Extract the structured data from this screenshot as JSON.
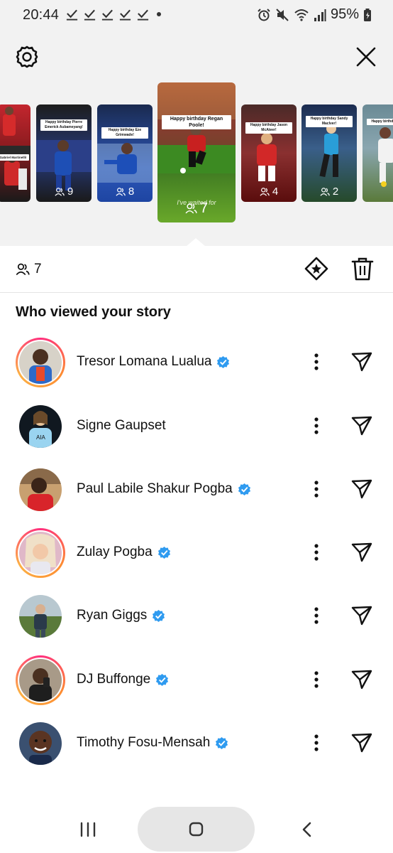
{
  "status_bar": {
    "time": "20:44",
    "battery": "95%",
    "icons": [
      "check-icon",
      "check-icon",
      "check-icon",
      "check-icon",
      "check-icon",
      "dot-icon",
      "alarm-icon",
      "mute-icon",
      "wifi-icon",
      "signal-icon",
      "battery-charging-icon"
    ]
  },
  "header": {
    "settings_icon": "settings-gear-icon",
    "close_icon": "close-icon"
  },
  "stories": [
    {
      "caption": "",
      "viewers": "",
      "colors": [
        "#c3262e",
        "#1a1a1a"
      ]
    },
    {
      "caption": "Happy birthday Pierre Emerick Aubameyang!",
      "viewers": "9",
      "colors": [
        "#2a2a2a",
        "#1d3f8f"
      ]
    },
    {
      "caption": "Happy birthday Eze Grimwade!",
      "viewers": "8",
      "colors": [
        "#17284f",
        "#1f49a8"
      ]
    },
    {
      "caption": "Happy birthday Regan Poole!",
      "viewers": "7",
      "overlay": "I've waited for",
      "colors": [
        "#b56a40",
        "#5b9d27"
      ]
    },
    {
      "caption": "Happy birthday Jason McAteer!",
      "viewers": "4",
      "colors": [
        "#4d2b28",
        "#7a1010"
      ]
    },
    {
      "caption": "Happy birthday Sandy MacIver!",
      "viewers": "2",
      "colors": [
        "#1c2d4d",
        "#284428"
      ]
    },
    {
      "caption": "Happy birthday S",
      "viewers": "",
      "colors": [
        "#5d7a85",
        "#5a7a3a"
      ]
    }
  ],
  "stats": {
    "viewer_count": "7",
    "highlight_icon": "highlight-star-icon",
    "delete_icon": "trash-icon"
  },
  "section_title": "Who viewed your story",
  "viewers": [
    {
      "name": "Tresor Lomana Lualua",
      "verified": true,
      "ring": true
    },
    {
      "name": "Signe Gaupset",
      "verified": false,
      "ring": false
    },
    {
      "name": "Paul Labile Shakur Pogba",
      "verified": true,
      "ring": false
    },
    {
      "name": "Zulay Pogba",
      "verified": true,
      "ring": true
    },
    {
      "name": "Ryan Giggs",
      "verified": true,
      "ring": false
    },
    {
      "name": "DJ Buffonge",
      "verified": true,
      "ring": true
    },
    {
      "name": "Timothy Fosu-Mensah",
      "verified": true,
      "ring": false
    }
  ],
  "colors": {
    "verified": "#2f9bf0",
    "ring_start": "#ff2e7e",
    "ring_end": "#fcb045"
  },
  "nav": {
    "recent_icon": "recent-apps-icon",
    "home_icon": "home-icon",
    "back_icon": "back-icon"
  }
}
